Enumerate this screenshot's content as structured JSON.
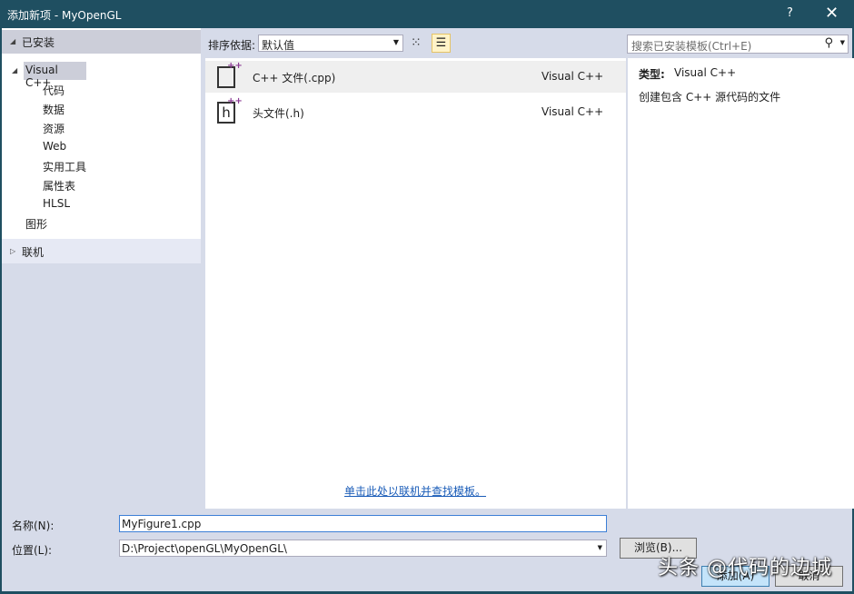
{
  "title": "添加新项 - MyOpenGL",
  "title_buttons": {
    "help": "?",
    "close": "✕"
  },
  "tree": {
    "installed": "已安装",
    "visual_cpp": "Visual C++",
    "children": [
      "代码",
      "数据",
      "资源",
      "Web",
      "实用工具",
      "属性表",
      "HLSL"
    ],
    "graphics": "图形",
    "online": "联机"
  },
  "toolbar": {
    "sort_label": "排序依据:",
    "sort_value": "默认值",
    "search_placeholder": "搜索已安装模板(Ctrl+E)"
  },
  "templates": [
    {
      "name": "C++ 文件(.cpp)",
      "type": "Visual C++",
      "icon": "cpp-file-icon"
    },
    {
      "name": "头文件(.h)",
      "type": "Visual C++",
      "icon": "header-file-icon"
    }
  ],
  "online_link": "单击此处以联机并查找模板。",
  "details": {
    "type_label": "类型:",
    "type_value": "Visual C++",
    "description": "创建包含 C++ 源代码的文件"
  },
  "form": {
    "name_label": "名称(N):",
    "name_value": "MyFigure1.cpp",
    "location_label": "位置(L):",
    "location_value": "D:\\Project\\openGL\\MyOpenGL\\",
    "browse": "浏览(B)...",
    "add": "添加(A)",
    "cancel": "取消"
  },
  "watermark": "头条 @代码的边城"
}
